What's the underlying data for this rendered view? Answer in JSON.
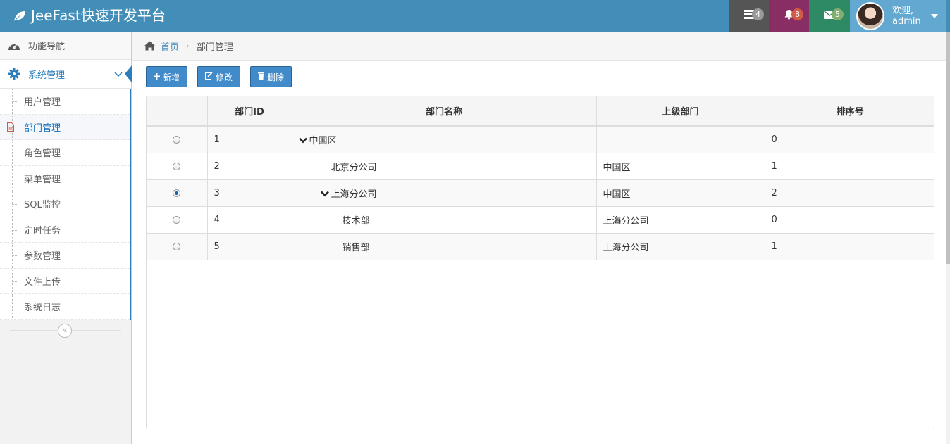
{
  "app": {
    "title": "JeeFast快速开发平台"
  },
  "header": {
    "tasks_count": "4",
    "notifications_count": "8",
    "messages_count": "5",
    "welcome_line1": "欢迎,",
    "welcome_line2": "admin"
  },
  "sidebar": {
    "nav_label": "功能导航",
    "system_label": "系统管理",
    "items": [
      {
        "label": "用户管理"
      },
      {
        "label": "部门管理"
      },
      {
        "label": "角色管理"
      },
      {
        "label": "菜单管理"
      },
      {
        "label": "SQL监控"
      },
      {
        "label": "定时任务"
      },
      {
        "label": "参数管理"
      },
      {
        "label": "文件上传"
      },
      {
        "label": "系统日志"
      }
    ],
    "collapse_glyph": "«"
  },
  "breadcrumb": {
    "home": "首页",
    "current": "部门管理"
  },
  "toolbar": {
    "add_label": "新增",
    "edit_label": "修改",
    "delete_label": "删除"
  },
  "table": {
    "columns": [
      "部门ID",
      "部门名称",
      "上级部门",
      "排序号"
    ],
    "rows": [
      {
        "id": "1",
        "name": "中国区",
        "parent": "",
        "order": "0",
        "selected": false,
        "expanded": true,
        "depth": 0
      },
      {
        "id": "2",
        "name": "北京分公司",
        "parent": "中国区",
        "order": "1",
        "selected": false,
        "expanded": false,
        "depth": 1
      },
      {
        "id": "3",
        "name": "上海分公司",
        "parent": "中国区",
        "order": "2",
        "selected": true,
        "expanded": true,
        "depth": 1
      },
      {
        "id": "4",
        "name": "技术部",
        "parent": "上海分公司",
        "order": "0",
        "selected": false,
        "expanded": false,
        "depth": 2
      },
      {
        "id": "5",
        "name": "销售部",
        "parent": "上海分公司",
        "order": "1",
        "selected": false,
        "expanded": false,
        "depth": 2
      }
    ]
  },
  "colors": {
    "topbar": "#438eb9",
    "accent": "#2b7dbc",
    "button": "#428bca",
    "badge_tasks": "#999999",
    "badge_notif": "#d15b47",
    "badge_msg": "#82af6f"
  }
}
